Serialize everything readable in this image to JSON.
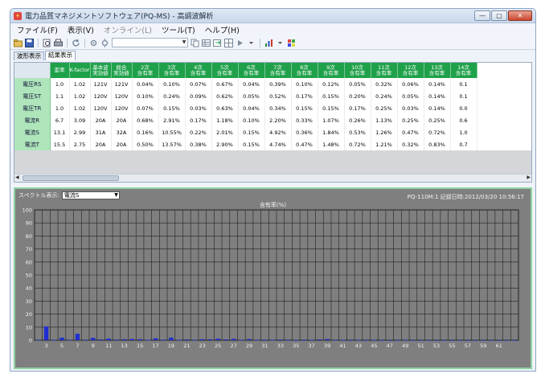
{
  "window": {
    "title": "電力品質マネジメントソフトウェア(PQ-MS) - 高調波解析",
    "buttons": [
      "—",
      "▢",
      "✕"
    ]
  },
  "menu": [
    {
      "label": "ファイル(F)",
      "enabled": true
    },
    {
      "label": "表示(V)",
      "enabled": true
    },
    {
      "label": "オンライン(L)",
      "enabled": false
    },
    {
      "label": "ツール(T)",
      "enabled": true
    },
    {
      "label": "ヘルプ(H)",
      "enabled": true
    }
  ],
  "tabs": [
    {
      "label": "波形表示",
      "active": false
    },
    {
      "label": "結果表示",
      "active": true
    }
  ],
  "table": {
    "columns": [
      "歪率",
      "K-factor",
      "基本波\n実効値",
      "総合\n実効値",
      "2次\n含有率",
      "3次\n含有率",
      "4次\n含有率",
      "5次\n含有率",
      "6次\n含有率",
      "7次\n含有率",
      "8次\n含有率",
      "9次\n含有率",
      "10次\n含有率",
      "11次\n含有率",
      "12次\n含有率",
      "13次\n含有率",
      "14次\n含有率"
    ],
    "rows": [
      {
        "label": "電圧RS",
        "values": [
          "1.0",
          "1.02",
          "121V",
          "121V",
          "0.04%",
          "0.10%",
          "0.07%",
          "0.67%",
          "0.04%",
          "0.39%",
          "0.10%",
          "0.12%",
          "0.05%",
          "0.32%",
          "0.06%",
          "0.14%",
          "0.1"
        ]
      },
      {
        "label": "電圧ST",
        "values": [
          "1.1",
          "1.02",
          "120V",
          "120V",
          "0.10%",
          "0.24%",
          "0.09%",
          "0.62%",
          "0.05%",
          "0.52%",
          "0.17%",
          "0.15%",
          "0.20%",
          "0.24%",
          "0.05%",
          "0.14%",
          "0.1"
        ]
      },
      {
        "label": "電圧TR",
        "values": [
          "1.0",
          "1.02",
          "120V",
          "120V",
          "0.07%",
          "0.15%",
          "0.03%",
          "0.63%",
          "0.04%",
          "0.34%",
          "0.15%",
          "0.15%",
          "0.17%",
          "0.25%",
          "0.03%",
          "0.14%",
          "0.0"
        ]
      },
      {
        "label": "電流R",
        "values": [
          "6.7",
          "3.09",
          "20A",
          "20A",
          "0.68%",
          "2.91%",
          "0.17%",
          "1.18%",
          "0.10%",
          "2.20%",
          "0.33%",
          "1.07%",
          "0.26%",
          "1.13%",
          "0.25%",
          "0.25%",
          "0.6"
        ]
      },
      {
        "label": "電流S",
        "values": [
          "13.1",
          "2.99",
          "31A",
          "32A",
          "0.16%",
          "10.55%",
          "0.22%",
          "2.01%",
          "0.15%",
          "4.92%",
          "0.36%",
          "1.84%",
          "0.53%",
          "1.26%",
          "0.47%",
          "0.72%",
          "1.0"
        ]
      },
      {
        "label": "電流T",
        "values": [
          "15.5",
          "2.75",
          "20A",
          "20A",
          "0.50%",
          "13.57%",
          "0.38%",
          "2.90%",
          "0.15%",
          "4.74%",
          "0.47%",
          "1.48%",
          "0.72%",
          "1.21%",
          "0.32%",
          "0.83%",
          "0.7"
        ]
      }
    ]
  },
  "spectrum": {
    "label": "スペクトル表示:",
    "selected": "電流S",
    "info": "PQ-110M:1  記録日時:2012/03/20 10:56:17"
  },
  "chart_data": {
    "type": "bar",
    "title": "含有率(%)",
    "ylim": [
      0,
      100
    ],
    "yticks": [
      0,
      10,
      20,
      30,
      40,
      50,
      60,
      70,
      80,
      90,
      100
    ],
    "xticks": [
      3,
      5,
      7,
      9,
      11,
      13,
      15,
      17,
      19,
      21,
      23,
      25,
      27,
      29,
      31,
      33,
      35,
      37,
      39,
      41,
      43,
      45,
      47,
      49,
      51,
      53,
      55,
      57,
      59,
      61
    ],
    "grid": true,
    "categories": [
      2,
      3,
      4,
      5,
      6,
      7,
      8,
      9,
      10,
      11,
      12,
      13,
      14,
      15,
      16,
      17,
      18,
      19,
      20,
      21,
      22,
      23,
      24,
      25,
      26,
      27,
      28,
      29,
      30,
      31,
      32,
      33,
      34,
      35,
      36,
      37,
      38,
      39,
      40,
      41,
      42,
      43,
      44,
      45,
      46,
      47,
      48,
      49,
      50,
      51,
      52,
      53,
      54,
      55,
      56,
      57,
      58,
      59,
      60,
      61,
      62,
      63
    ],
    "values": [
      0.16,
      10.55,
      0.22,
      2.01,
      0.15,
      4.92,
      0.36,
      1.84,
      0.53,
      1.26,
      0.47,
      0.72,
      1.0,
      0.8,
      0.3,
      1.5,
      0.4,
      2.0,
      0.3,
      0.6,
      0.2,
      0.8,
      0.7,
      1.2,
      0.6,
      1.1,
      0.3,
      0.9,
      0.2,
      0.4,
      0.2,
      0.5,
      0.1,
      0.2,
      0.1,
      0.3,
      0.6,
      0.9,
      0.2,
      0.3,
      0.1,
      0.2,
      0.1,
      0.2,
      0.1,
      0.1,
      0.1,
      0.2,
      0.1,
      0.1,
      0.1,
      0.1,
      0.1,
      0.1,
      0.1,
      0.1,
      0.1,
      0.1,
      0.1,
      0.1,
      0.1,
      0.1
    ],
    "bar_color": "#1f2fd0"
  },
  "colors": {
    "header_green": "#1fa14a",
    "rowhead_green": "#aee5bb",
    "chart_bg": "#7f7f7f",
    "border_green": "#8fd3a1"
  }
}
